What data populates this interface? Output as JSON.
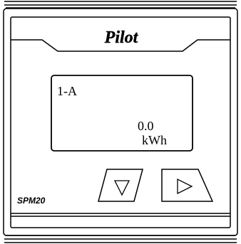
{
  "device": {
    "brand": "Pilot",
    "model": "SPM20"
  },
  "display": {
    "channel": "1-A",
    "value": "0.0",
    "unit": "kWh"
  },
  "buttons": {
    "down": {
      "icon": "triangle-down-icon"
    },
    "right": {
      "icon": "triangle-right-icon"
    }
  },
  "colors": {
    "outline": "#000000",
    "background": "#ffffff"
  }
}
